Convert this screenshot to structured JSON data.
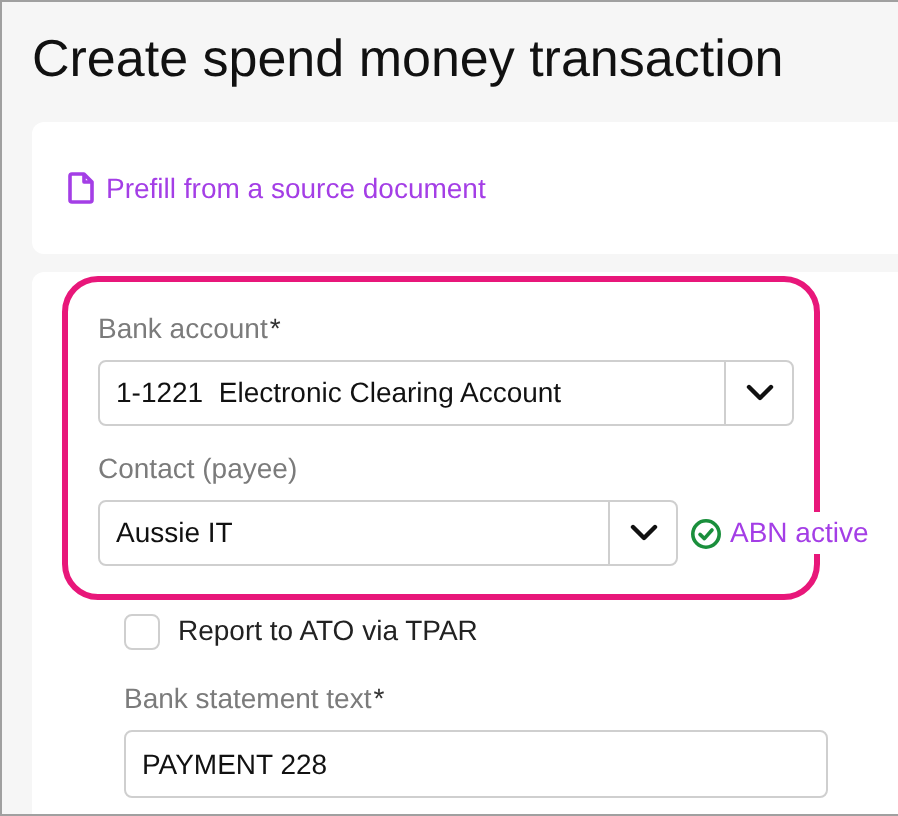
{
  "title": "Create spend money transaction",
  "prefill": {
    "label": "Prefill from a source document"
  },
  "highlight": {
    "on": true
  },
  "highlighted_fields": [
    {
      "kind": "select",
      "label": "Bank account",
      "required_mark": "*",
      "value": "1-1221  Electronic Clearing Account"
    },
    {
      "kind": "select",
      "label": "Contact (payee)",
      "value": "Aussie IT",
      "status": "ABN active"
    }
  ],
  "tpar": {
    "label": "Report to ATO via TPAR",
    "checked": false
  },
  "statement": {
    "label": "Bank statement text",
    "required_mark": "*",
    "value": "PAYMENT 228"
  }
}
